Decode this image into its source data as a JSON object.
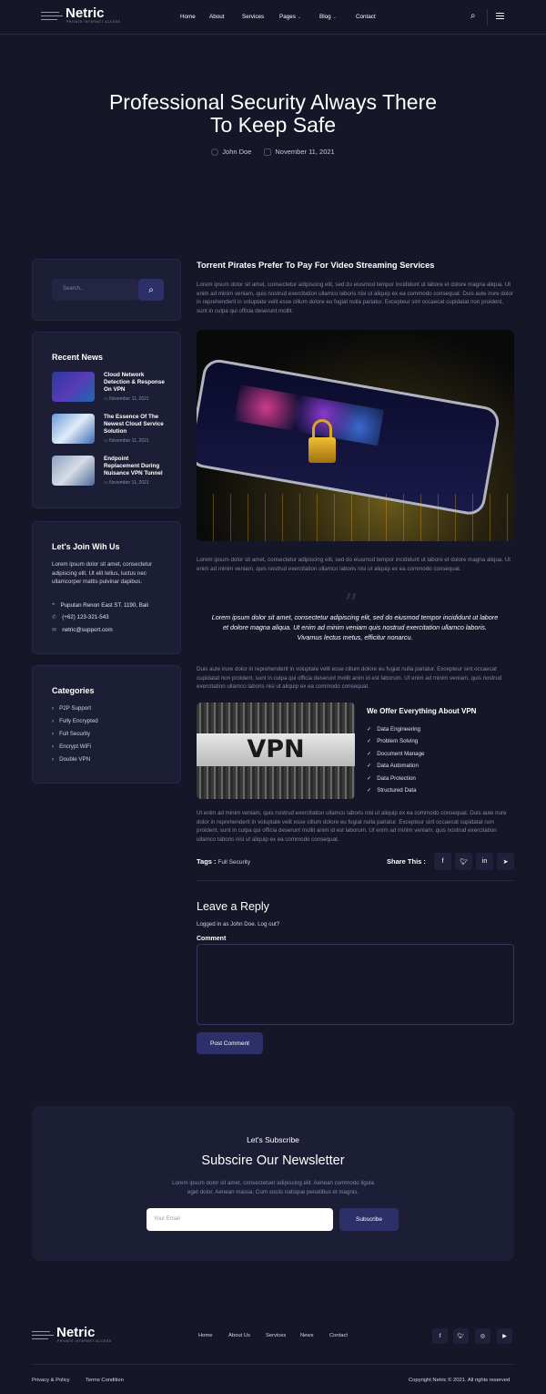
{
  "brand": {
    "name": "Netric",
    "tagline": "PRIVATE INTERNET ACCESS"
  },
  "nav": {
    "items": [
      {
        "label": "Home"
      },
      {
        "label": "About"
      },
      {
        "label": "Services"
      },
      {
        "label": "Pages"
      },
      {
        "label": "Blog"
      },
      {
        "label": "Contact"
      }
    ]
  },
  "hero": {
    "title_line1": "Professional Security Always There",
    "title_line2": "To Keep Safe",
    "author": "John Doe",
    "date": "November 11, 2021"
  },
  "sidebar": {
    "search_placeholder": "Search..",
    "recent_news_title": "Recent News",
    "news": [
      {
        "title": "Cloud Network Detection & Response On VPN",
        "date": "November 11, 2021"
      },
      {
        "title": "The Essence Of The Newest Cloud Service Solution",
        "date": "November 11, 2021"
      },
      {
        "title": "Endpoint Replacement During Nuisance VPN Tunnel",
        "date": "November 11, 2021"
      }
    ],
    "join_title": "Let's Join Wih Us",
    "join_text": "Lorem ipsum dolor sit amet, consectetur adipiscing elit. Ut elit tellus, luctus nec ullamcorper mattis pulvinar dapibus.",
    "address": "Puputan Renon East ST. 1190, Bali",
    "phone": "(+62) 123-321-543",
    "email": "netric@support.com",
    "categories_title": "Categories",
    "categories": [
      "P2P Support",
      "Fully Encrypted",
      "Full Security",
      "Encrypt WiFi",
      "Double VPN"
    ]
  },
  "article": {
    "heading": "Torrent Pirates Prefer To Pay For Video Streaming Services",
    "para1": "Lorem ipsum dolor sit amet, consectetur adipiscing elit, sed do eiusmod tempor incididunt ut labore et dolore magna aliqua. Ut enim ad minim veniam, quis nostrud exercitation ullamco laboris nisi ut aliquip ex ea commodo consequat. Duis aute irure dolor in reprehenderit in voluptate velit esse cillum dolore eu fugiat nulla pariatur. Excepteur sint occaecat cupidatat non proident, sunt in culpa qui officia deserunt mollit.",
    "para2": "Lorem ipsum dolor sit amet, consectetur adipiscing elit, sed do eiusmod tempor incididunt ut labore et dolore magna aliqua. Ut enim ad minim veniam, quis nostrud exercitation ullamco laboris nisi ut aliquip ex ea commodo consequat.",
    "quote": "Lorem ipsum dolor sit amet, consectetur adipiscing elit, sed do eiusmod tempor incididunt ut labore et dolore magna aliqua. Ut enim ad minim veniam quis nostrud exercitation ullamco laboris. Vivamus lectus metus, efficitur nonarcu.",
    "para3": "Duis aute irure dolor in reprehenderit in voluptate velit esse cillum dolore eu fugiat nulla pariatur. Excepteur sint occaecat cupidatat non proident, sunt in culpa qui officia deserunt mollit anim id est laborum. Ut enim ad minim veniam, quis nostrud exercitation ullamco laboris nisi ut aliquip ex ea commodo consequat.",
    "vpn_label": "VPN",
    "offer_title": "We Offer Everything About VPN",
    "offers": [
      "Data Engineering",
      "Problem Solving",
      "Document Manage",
      "Data Automation",
      "Data Protection",
      "Structured Data"
    ],
    "para4": "Ut enim ad minim veniam, quis nostrud exercitation ullamco laboris nisi ut aliquip ex ea commodo consequat. Duis aute irure dolor in reprehenderit in voluptate velit esse cillum dolore eu fugiat nulla pariatur. Excepteur sint occaecat cupidatat non proident, sunt in culpa qui officia deserunt mollit anim id est laborum. Ut enim ad minim veniam, quis nostrud exercitation ullamco laboris nisi ut aliquip ex ea commodo consequat.",
    "tags_label": "Tags :",
    "tag": "Full Security",
    "share_label": "Share This :"
  },
  "reply": {
    "title": "Leave a Reply",
    "logged_in": "Logged in as John Doe. Log out?",
    "comment_label": "Comment",
    "submit": "Post Comment"
  },
  "newsletter": {
    "kicker": "Let's Subscribe",
    "title": "Subscire Our Newsletter",
    "text_line1": "Lorem ipsum dolor sit amet, consectetuer adipiscing elit. Aenean commodo ligula",
    "text_line2": "eget dolor. Aenean massa. Cum sociis natoque penatibus et magnis.",
    "placeholder": "Your Email",
    "button": "Subscribe"
  },
  "footer": {
    "nav": [
      "Home",
      "About Us",
      "Services",
      "News",
      "Contact"
    ],
    "privacy": "Privacy & Policy",
    "terms": "Terms Condition",
    "copyright": "Copyright Netric © 2021. All rights reserved"
  },
  "colors": {
    "background": "#151628",
    "card": "#1c1e36",
    "accent": "#2d2f68"
  }
}
